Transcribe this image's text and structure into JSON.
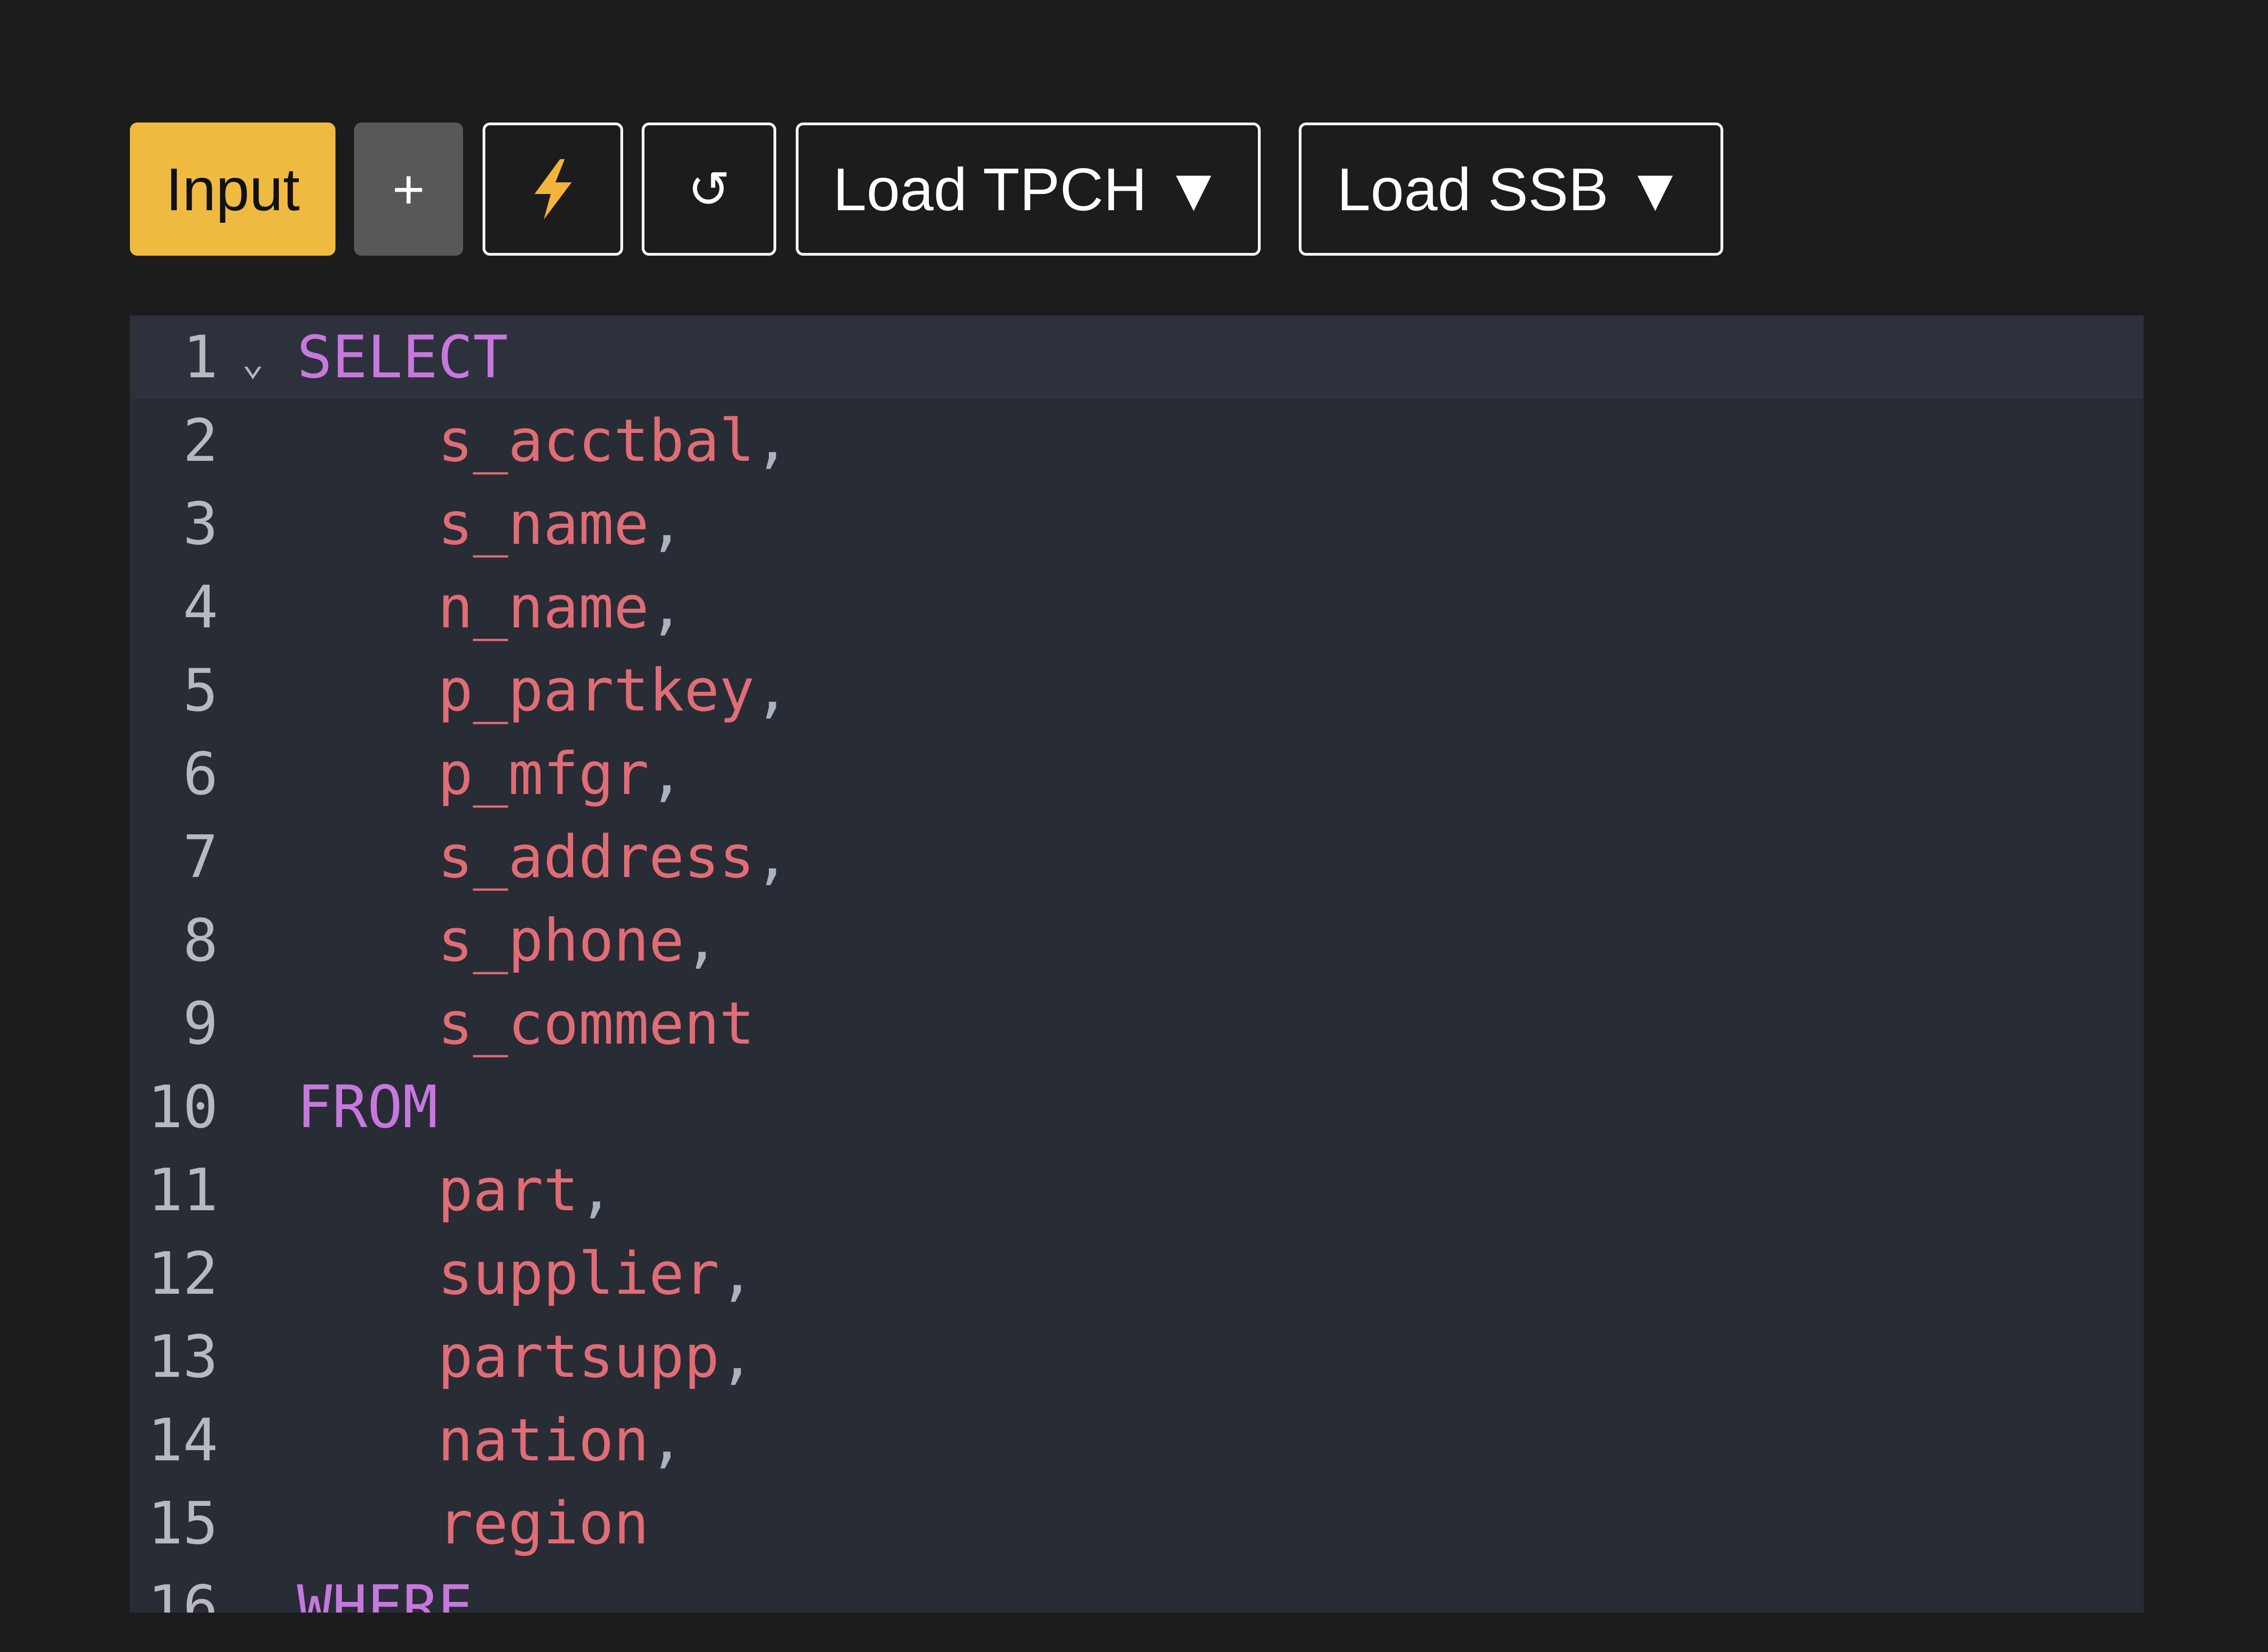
{
  "toolbar": {
    "input_label": "Input",
    "add_label": "+",
    "undo_label": "↺",
    "load_tpch_label": "Load TPCH ▼",
    "load_ssb_label": "Load SSB ▼"
  },
  "colors": {
    "page_bg": "#1c1c1d",
    "input_button": "#eeba3f",
    "add_button": "#58585a",
    "editor_bg": "#282c34",
    "keyword": "#c678dd",
    "identifier": "#e06c75",
    "punctuation": "#abb2bf",
    "line_number": "#b7b9be"
  },
  "icons": {
    "bolt": "lightning-bolt-icon",
    "undo": "undo-icon",
    "fold": "chevron-down-icon"
  },
  "editor": {
    "lines": [
      {
        "num": "1",
        "indent": "",
        "text": "SELECT",
        "kind": "kw",
        "punc": ""
      },
      {
        "num": "2",
        "indent": "    ",
        "text": "s_acctbal",
        "kind": "id",
        "punc": ","
      },
      {
        "num": "3",
        "indent": "    ",
        "text": "s_name",
        "kind": "id",
        "punc": ","
      },
      {
        "num": "4",
        "indent": "    ",
        "text": "n_name",
        "kind": "id",
        "punc": ","
      },
      {
        "num": "5",
        "indent": "    ",
        "text": "p_partkey",
        "kind": "id",
        "punc": ","
      },
      {
        "num": "6",
        "indent": "    ",
        "text": "p_mfgr",
        "kind": "id",
        "punc": ","
      },
      {
        "num": "7",
        "indent": "    ",
        "text": "s_address",
        "kind": "id",
        "punc": ","
      },
      {
        "num": "8",
        "indent": "    ",
        "text": "s_phone",
        "kind": "id",
        "punc": ","
      },
      {
        "num": "9",
        "indent": "    ",
        "text": "s_comment",
        "kind": "id",
        "punc": ""
      },
      {
        "num": "10",
        "indent": "",
        "text": "FROM",
        "kind": "kw",
        "punc": ""
      },
      {
        "num": "11",
        "indent": "    ",
        "text": "part",
        "kind": "id",
        "punc": ","
      },
      {
        "num": "12",
        "indent": "    ",
        "text": "supplier",
        "kind": "id",
        "punc": ","
      },
      {
        "num": "13",
        "indent": "    ",
        "text": "partsupp",
        "kind": "id",
        "punc": ","
      },
      {
        "num": "14",
        "indent": "    ",
        "text": "nation",
        "kind": "id",
        "punc": ","
      },
      {
        "num": "15",
        "indent": "    ",
        "text": "region",
        "kind": "id",
        "punc": ""
      },
      {
        "num": "16",
        "indent": "",
        "text": "WHERE",
        "kind": "kw",
        "punc": ""
      }
    ]
  }
}
